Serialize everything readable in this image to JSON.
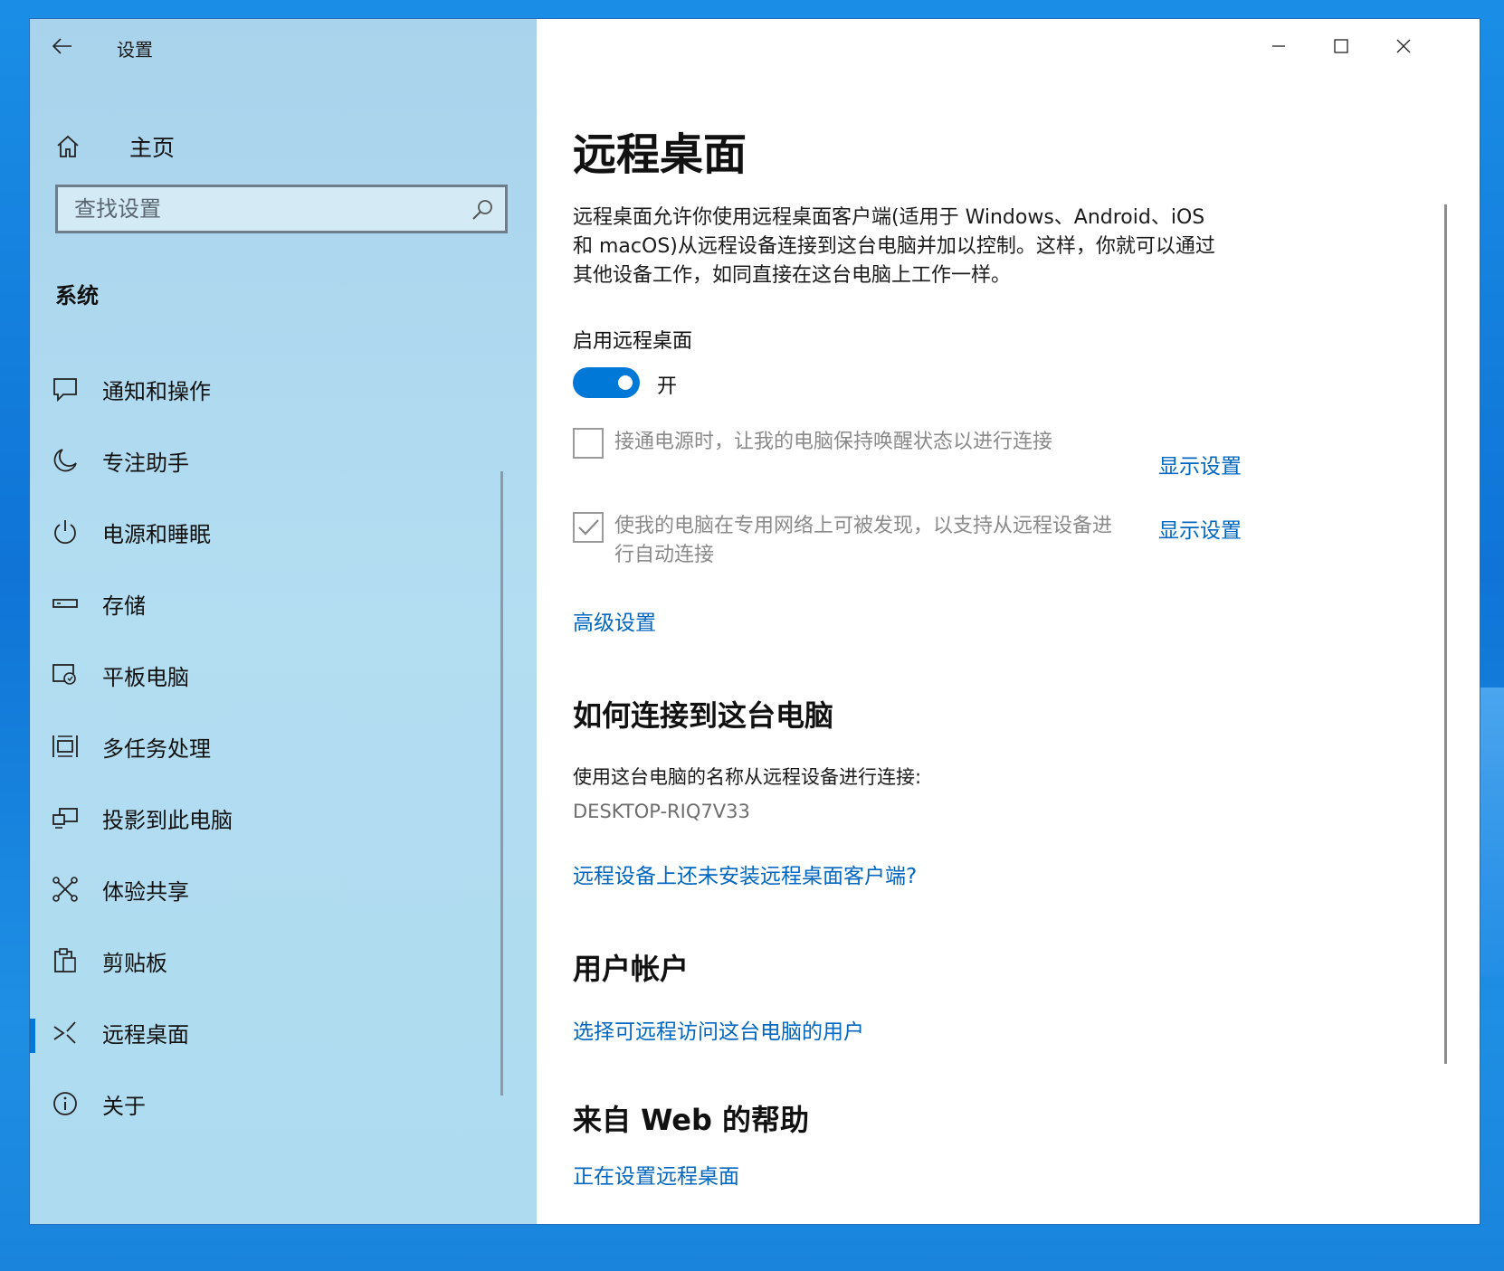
{
  "window": {
    "title": "设置",
    "controls": {
      "minimize": "minimize",
      "maximize": "maximize",
      "close": "close"
    }
  },
  "sidebar": {
    "home_label": "主页",
    "search_placeholder": "查找设置",
    "section_label": "系统",
    "items": [
      {
        "label": "通知和操作",
        "icon": "notification-icon"
      },
      {
        "label": "专注助手",
        "icon": "moon-icon"
      },
      {
        "label": "电源和睡眠",
        "icon": "power-icon"
      },
      {
        "label": "存储",
        "icon": "storage-icon"
      },
      {
        "label": "平板电脑",
        "icon": "tablet-icon"
      },
      {
        "label": "多任务处理",
        "icon": "multitask-icon"
      },
      {
        "label": "投影到此电脑",
        "icon": "project-icon"
      },
      {
        "label": "体验共享",
        "icon": "share-icon"
      },
      {
        "label": "剪贴板",
        "icon": "clipboard-icon"
      },
      {
        "label": "远程桌面",
        "icon": "remote-desktop-icon",
        "active": true
      },
      {
        "label": "关于",
        "icon": "info-icon"
      }
    ]
  },
  "main": {
    "title": "远程桌面",
    "description_lines": [
      "远程桌面允许你使用远程桌面客户端(适用于 Windows、Android、iOS",
      "和 macOS)从远程设备连接到这台电脑并加以控制。这样，你就可以通过",
      "其他设备工作，如同直接在这台电脑上工作一样。"
    ],
    "toggle_label": "启用远程桌面",
    "toggle_state": "开",
    "toggle_on": true,
    "option1": {
      "text": "接通电源时，让我的电脑保持唤醒状态以进行连接",
      "checked": false,
      "link": "显示设置"
    },
    "option2": {
      "text_lines": [
        "使我的电脑在专用网络上可被发现，以支持从远程设备进",
        "行自动连接"
      ],
      "checked": true,
      "link": "显示设置"
    },
    "advanced_link": "高级设置",
    "how_to_connect": {
      "heading": "如何连接到这台电脑",
      "instruction": "使用这台电脑的名称从远程设备进行连接:",
      "pc_name": "DESKTOP-RIQ7V33",
      "client_link": "远程设备上还未安装远程桌面客户端?"
    },
    "user_accounts": {
      "heading": "用户帐户",
      "link": "选择可远程访问这台电脑的用户"
    },
    "web_help": {
      "heading": "来自 Web 的帮助",
      "link": "正在设置远程桌面"
    }
  },
  "colors": {
    "accent": "#0078d7",
    "link": "#0067c0",
    "sidebar": "#b0dbf0"
  }
}
